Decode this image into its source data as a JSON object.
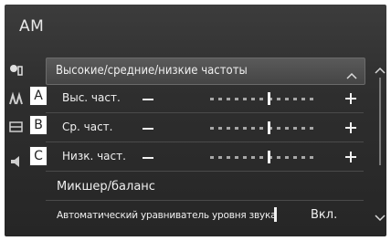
{
  "screen": {
    "title": "AM"
  },
  "tone": {
    "header_label": "Высокие/средние/низкие частоты",
    "rows": [
      {
        "callout": "A",
        "label": "Выс. част.",
        "level_index": 7,
        "steps": 13
      },
      {
        "callout": "B",
        "label": "Ср. част.",
        "level_index": 7,
        "steps": 13
      },
      {
        "callout": "C",
        "label": "Низк. част.",
        "level_index": 7,
        "steps": 13
      }
    ]
  },
  "mixer": {
    "label": "Микшер/баланс"
  },
  "auto_level": {
    "label": "Автоматический уравниватель уровня звука",
    "value": "Вкл."
  },
  "icons": {
    "tone_icon": "speaker-tone-icon",
    "treble_icon": "treble-icon",
    "mid_icon": "mid-icon",
    "bass_icon": "bass-icon"
  }
}
